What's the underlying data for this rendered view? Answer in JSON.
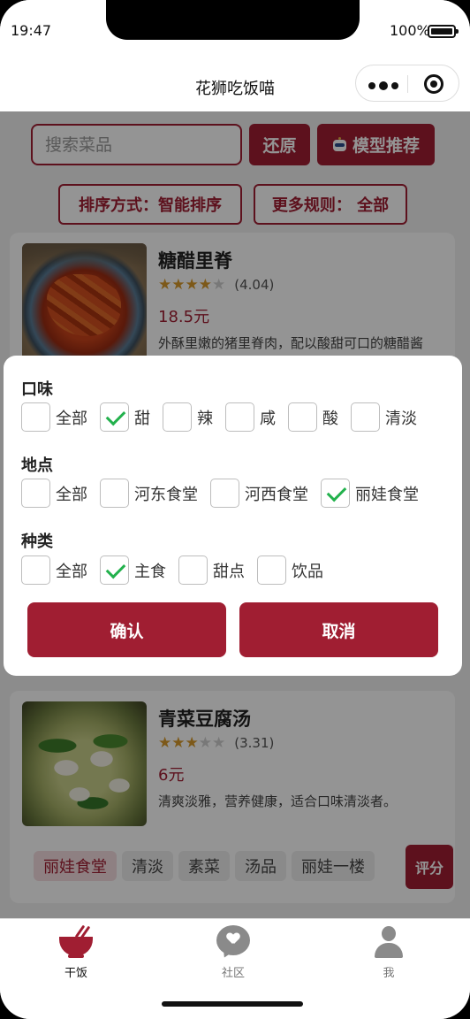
{
  "status_bar": {
    "time": "19:47",
    "battery": "100%"
  },
  "nav": {
    "title": "花狮吃饭喵"
  },
  "search": {
    "placeholder": "搜索菜品",
    "reset_label": "还原",
    "model_label": "模型推荐"
  },
  "sort": {
    "sort_label": "排序方式：智能排序",
    "rules_label": "更多规则：  全部"
  },
  "dishes": [
    {
      "name": "糖醋里脊",
      "rating": 4.04,
      "rating_text": "(4.04)",
      "price": "18.5元",
      "desc": "外酥里嫩的猪里脊肉，配以酸甜可口的糖醋酱汁，色泽红亮。"
    },
    {
      "name": "青菜豆腐汤",
      "rating": 3.31,
      "rating_text": "(3.31)",
      "price": "6元",
      "desc": "清爽淡雅，营养健康，适合口味清淡者。",
      "tags": [
        "丽娃食堂",
        "清淡",
        "素菜",
        "汤品",
        "丽娃一楼"
      ]
    }
  ],
  "rate_label": "评分",
  "filter": {
    "taste": {
      "title": "口味",
      "options": [
        {
          "label": "全部",
          "checked": false
        },
        {
          "label": "甜",
          "checked": true
        },
        {
          "label": "辣",
          "checked": false
        },
        {
          "label": "咸",
          "checked": false
        },
        {
          "label": "酸",
          "checked": false
        },
        {
          "label": "清淡",
          "checked": false
        }
      ]
    },
    "location": {
      "title": "地点",
      "options": [
        {
          "label": "全部",
          "checked": false
        },
        {
          "label": "河东食堂",
          "checked": false
        },
        {
          "label": "河西食堂",
          "checked": false
        },
        {
          "label": "丽娃食堂",
          "checked": true
        }
      ]
    },
    "category": {
      "title": "种类",
      "options": [
        {
          "label": "全部",
          "checked": false
        },
        {
          "label": "主食",
          "checked": true
        },
        {
          "label": "甜点",
          "checked": false
        },
        {
          "label": "饮品",
          "checked": false
        }
      ]
    },
    "confirm_label": "确认",
    "cancel_label": "取消"
  },
  "tabs": [
    {
      "label": "干饭",
      "icon": "bowl-icon",
      "active": true
    },
    {
      "label": "社区",
      "icon": "chat-icon",
      "active": false
    },
    {
      "label": "我",
      "icon": "person-icon",
      "active": false
    }
  ],
  "colors": {
    "accent": "#a01e32",
    "check": "#22b14c",
    "star": "#d79a2b"
  }
}
